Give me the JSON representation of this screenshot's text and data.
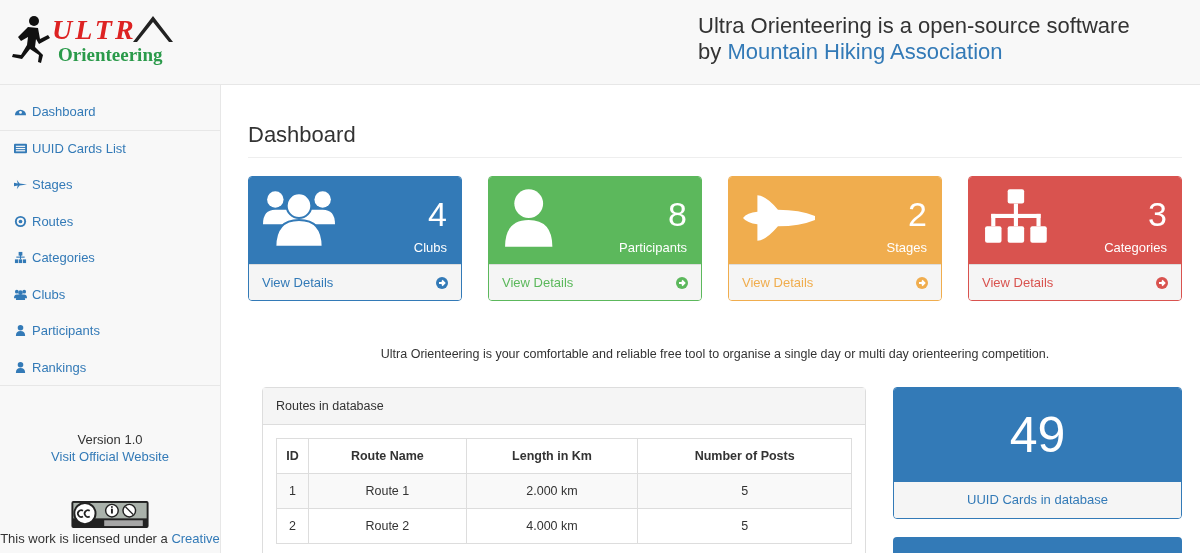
{
  "header": {
    "logo": {
      "line1": "ULTR",
      "line2": "Orienteering"
    },
    "tagline": "Ultra Orienteering is a open-source software",
    "by": "by",
    "org_link": "Mountain Hiking Association"
  },
  "sidebar": {
    "items": [
      {
        "label": "Dashboard",
        "kind": "dashboard"
      },
      {
        "label": "UUID Cards List",
        "kind": "list"
      },
      {
        "label": "Stages",
        "kind": "plane"
      },
      {
        "label": "Routes",
        "kind": "target"
      },
      {
        "label": "Categories",
        "kind": "sitemap"
      },
      {
        "label": "Clubs",
        "kind": "users"
      },
      {
        "label": "Participants",
        "kind": "user"
      },
      {
        "label": "Rankings",
        "kind": "user"
      }
    ],
    "version": "Version 1.0",
    "website_link": "Visit Official Website",
    "license_text": "This work is licensed under a",
    "license_link": "Creative"
  },
  "page_title": "Dashboard",
  "panels": [
    {
      "count": "4",
      "label": "Clubs",
      "kind": "users",
      "color": "#337ab7",
      "footer": "View Details"
    },
    {
      "count": "8",
      "label": "Participants",
      "kind": "user",
      "color": "#5cb85c",
      "footer": "View Details"
    },
    {
      "count": "2",
      "label": "Stages",
      "kind": "shuttle",
      "color": "#f0ad4e",
      "footer": "View Details"
    },
    {
      "count": "3",
      "label": "Categories",
      "kind": "sitemap",
      "color": "#d9534f",
      "footer": "View Details"
    }
  ],
  "description": "Ultra Orienteering is your comfortable and reliable free tool to organise a single day or multi day orienteering competition.",
  "routes": {
    "heading": "Routes in database",
    "columns": [
      "ID",
      "Route Name",
      "Length in Km",
      "Number of Posts"
    ],
    "rows": [
      [
        "1",
        "Route 1",
        "2.000 km",
        "5"
      ],
      [
        "2",
        "Route 2",
        "4.000 km",
        "5"
      ]
    ]
  },
  "stat": {
    "count": "49",
    "label": "UUID Cards in database"
  }
}
